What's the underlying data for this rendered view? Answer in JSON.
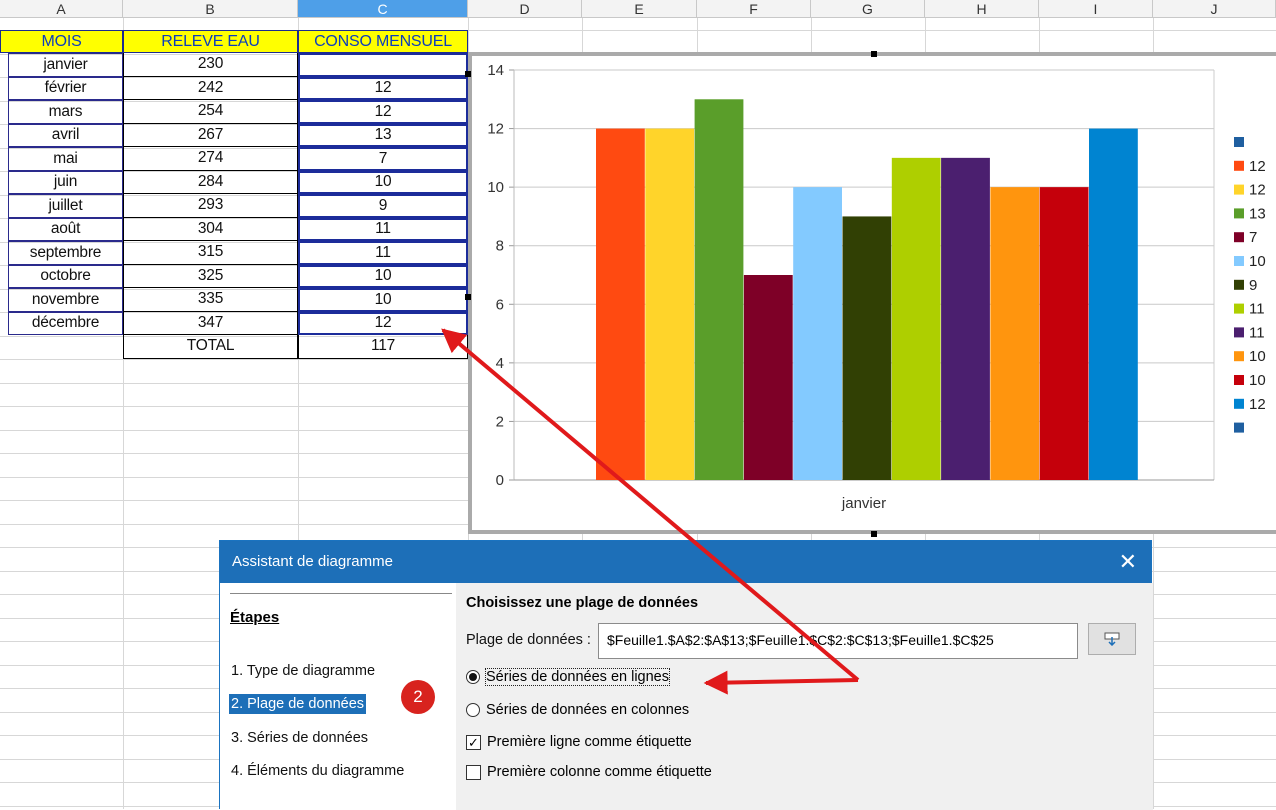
{
  "columns": [
    "A",
    "B",
    "C",
    "D",
    "E",
    "F",
    "G",
    "H",
    "I",
    "J"
  ],
  "selected_column": "C",
  "table": {
    "headers": [
      "MOIS",
      "RELEVE EAU",
      "CONSO MENSUEL"
    ],
    "rows": [
      {
        "mois": "janvier",
        "releve": "230",
        "conso": ""
      },
      {
        "mois": "février",
        "releve": "242",
        "conso": "12"
      },
      {
        "mois": "mars",
        "releve": "254",
        "conso": "12"
      },
      {
        "mois": "avril",
        "releve": "267",
        "conso": "13"
      },
      {
        "mois": "mai",
        "releve": "274",
        "conso": "7"
      },
      {
        "mois": "juin",
        "releve": "284",
        "conso": "10"
      },
      {
        "mois": "juillet",
        "releve": "293",
        "conso": "9"
      },
      {
        "mois": "août",
        "releve": "304",
        "conso": "11"
      },
      {
        "mois": "septembre",
        "releve": "315",
        "conso": "11"
      },
      {
        "mois": "octobre",
        "releve": "325",
        "conso": "10"
      },
      {
        "mois": "novembre",
        "releve": "335",
        "conso": "10"
      },
      {
        "mois": "décembre",
        "releve": "347",
        "conso": "12"
      }
    ],
    "total_label": "TOTAL",
    "total_value": "117"
  },
  "chart_data": {
    "type": "bar",
    "categories": [
      "janvier"
    ],
    "ylim": [
      0,
      14
    ],
    "yticks": [
      0,
      2,
      4,
      6,
      8,
      10,
      12,
      14
    ],
    "grid": true,
    "legend_position": "right",
    "series": [
      {
        "name": "",
        "value": null,
        "color": "#1f5fa0"
      },
      {
        "name": "12",
        "value": 12,
        "color": "#ff4a11"
      },
      {
        "name": "12",
        "value": 12,
        "color": "#ffd42a"
      },
      {
        "name": "13",
        "value": 13,
        "color": "#5a9e2a"
      },
      {
        "name": "7",
        "value": 7,
        "color": "#7e0027"
      },
      {
        "name": "10",
        "value": 10,
        "color": "#83caff"
      },
      {
        "name": "9",
        "value": 9,
        "color": "#314004"
      },
      {
        "name": "11",
        "value": 11,
        "color": "#aecf00"
      },
      {
        "name": "11",
        "value": 11,
        "color": "#4b1f6f"
      },
      {
        "name": "10",
        "value": 10,
        "color": "#ff950e"
      },
      {
        "name": "10",
        "value": 10,
        "color": "#c5000b"
      },
      {
        "name": "12",
        "value": 12,
        "color": "#0084d1"
      },
      {
        "name": "",
        "value": null,
        "color": "#1f5fa0"
      }
    ]
  },
  "dialog": {
    "title": "Assistant de diagramme",
    "close_glyph": "✕",
    "steps_title": "Étapes",
    "steps": [
      {
        "label": "1. Type de diagramme",
        "selected": false
      },
      {
        "label": "2. Plage de données",
        "selected": true
      },
      {
        "label": "3. Séries de données",
        "selected": false
      },
      {
        "label": "4. Éléments du diagramme",
        "selected": false
      }
    ],
    "section_title": "Choisissez une plage de données",
    "range_label": "Plage de données :",
    "range_value": "$Feuille1.$A$2:$A$13;$Feuille1.$C$2:$C$13;$Feuille1.$C$25",
    "options": {
      "rows": "Séries de données en lignes",
      "columns": "Séries de données en colonnes",
      "first_row_label": "Première ligne comme étiquette",
      "first_col_label": "Première colonne comme étiquette"
    },
    "state": {
      "series_in": "rows",
      "first_row_label": true,
      "first_col_label": false
    }
  },
  "annotation": {
    "badge": "2"
  },
  "colors": {
    "accent": "#1d6fb8",
    "arrow": "#e0191b",
    "header_fill": "#ffff00",
    "header_text": "#0b3dbd"
  }
}
